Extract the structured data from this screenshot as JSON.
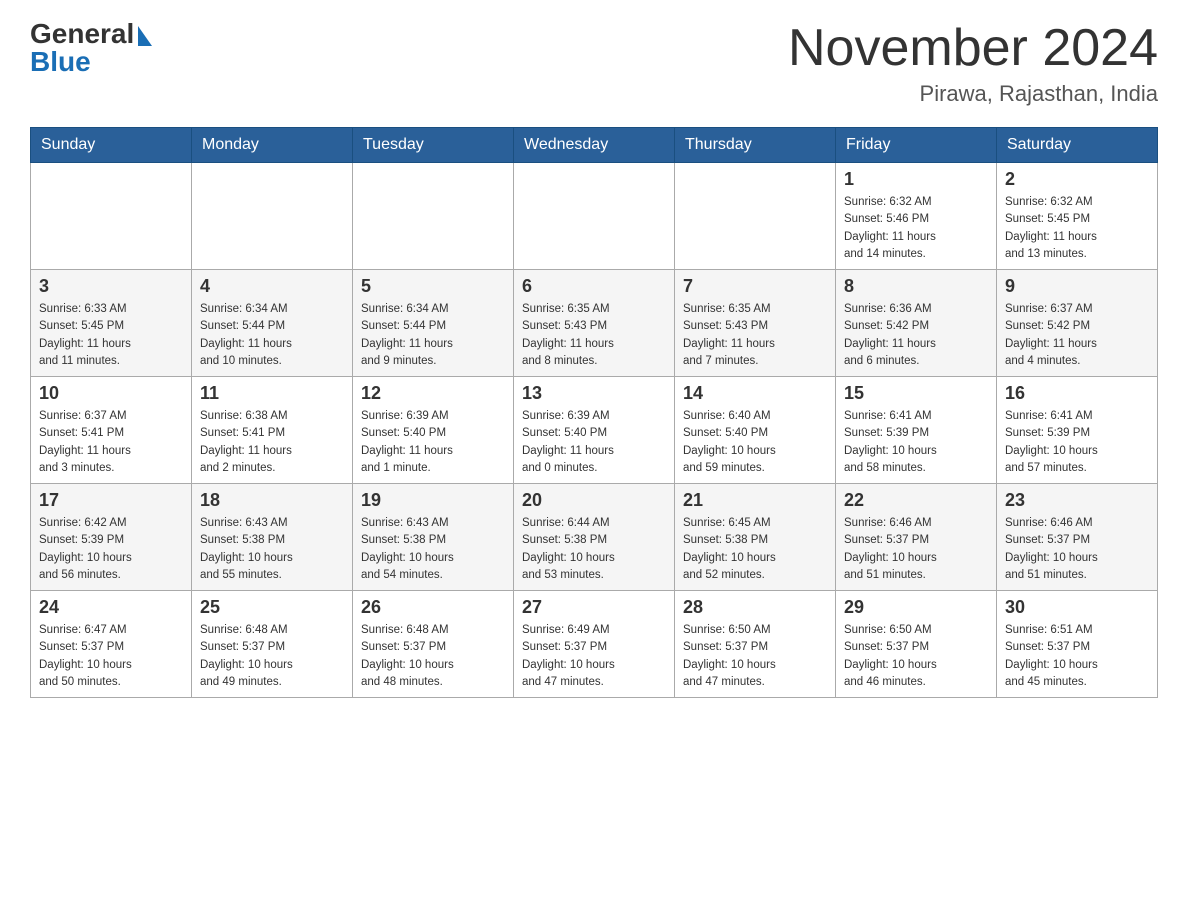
{
  "header": {
    "logo_general": "General",
    "logo_blue": "Blue",
    "calendar_title": "November 2024",
    "calendar_subtitle": "Pirawa, Rajasthan, India"
  },
  "weekdays": [
    "Sunday",
    "Monday",
    "Tuesday",
    "Wednesday",
    "Thursday",
    "Friday",
    "Saturday"
  ],
  "weeks": [
    [
      {
        "day": "",
        "info": ""
      },
      {
        "day": "",
        "info": ""
      },
      {
        "day": "",
        "info": ""
      },
      {
        "day": "",
        "info": ""
      },
      {
        "day": "",
        "info": ""
      },
      {
        "day": "1",
        "info": "Sunrise: 6:32 AM\nSunset: 5:46 PM\nDaylight: 11 hours\nand 14 minutes."
      },
      {
        "day": "2",
        "info": "Sunrise: 6:32 AM\nSunset: 5:45 PM\nDaylight: 11 hours\nand 13 minutes."
      }
    ],
    [
      {
        "day": "3",
        "info": "Sunrise: 6:33 AM\nSunset: 5:45 PM\nDaylight: 11 hours\nand 11 minutes."
      },
      {
        "day": "4",
        "info": "Sunrise: 6:34 AM\nSunset: 5:44 PM\nDaylight: 11 hours\nand 10 minutes."
      },
      {
        "day": "5",
        "info": "Sunrise: 6:34 AM\nSunset: 5:44 PM\nDaylight: 11 hours\nand 9 minutes."
      },
      {
        "day": "6",
        "info": "Sunrise: 6:35 AM\nSunset: 5:43 PM\nDaylight: 11 hours\nand 8 minutes."
      },
      {
        "day": "7",
        "info": "Sunrise: 6:35 AM\nSunset: 5:43 PM\nDaylight: 11 hours\nand 7 minutes."
      },
      {
        "day": "8",
        "info": "Sunrise: 6:36 AM\nSunset: 5:42 PM\nDaylight: 11 hours\nand 6 minutes."
      },
      {
        "day": "9",
        "info": "Sunrise: 6:37 AM\nSunset: 5:42 PM\nDaylight: 11 hours\nand 4 minutes."
      }
    ],
    [
      {
        "day": "10",
        "info": "Sunrise: 6:37 AM\nSunset: 5:41 PM\nDaylight: 11 hours\nand 3 minutes."
      },
      {
        "day": "11",
        "info": "Sunrise: 6:38 AM\nSunset: 5:41 PM\nDaylight: 11 hours\nand 2 minutes."
      },
      {
        "day": "12",
        "info": "Sunrise: 6:39 AM\nSunset: 5:40 PM\nDaylight: 11 hours\nand 1 minute."
      },
      {
        "day": "13",
        "info": "Sunrise: 6:39 AM\nSunset: 5:40 PM\nDaylight: 11 hours\nand 0 minutes."
      },
      {
        "day": "14",
        "info": "Sunrise: 6:40 AM\nSunset: 5:40 PM\nDaylight: 10 hours\nand 59 minutes."
      },
      {
        "day": "15",
        "info": "Sunrise: 6:41 AM\nSunset: 5:39 PM\nDaylight: 10 hours\nand 58 minutes."
      },
      {
        "day": "16",
        "info": "Sunrise: 6:41 AM\nSunset: 5:39 PM\nDaylight: 10 hours\nand 57 minutes."
      }
    ],
    [
      {
        "day": "17",
        "info": "Sunrise: 6:42 AM\nSunset: 5:39 PM\nDaylight: 10 hours\nand 56 minutes."
      },
      {
        "day": "18",
        "info": "Sunrise: 6:43 AM\nSunset: 5:38 PM\nDaylight: 10 hours\nand 55 minutes."
      },
      {
        "day": "19",
        "info": "Sunrise: 6:43 AM\nSunset: 5:38 PM\nDaylight: 10 hours\nand 54 minutes."
      },
      {
        "day": "20",
        "info": "Sunrise: 6:44 AM\nSunset: 5:38 PM\nDaylight: 10 hours\nand 53 minutes."
      },
      {
        "day": "21",
        "info": "Sunrise: 6:45 AM\nSunset: 5:38 PM\nDaylight: 10 hours\nand 52 minutes."
      },
      {
        "day": "22",
        "info": "Sunrise: 6:46 AM\nSunset: 5:37 PM\nDaylight: 10 hours\nand 51 minutes."
      },
      {
        "day": "23",
        "info": "Sunrise: 6:46 AM\nSunset: 5:37 PM\nDaylight: 10 hours\nand 51 minutes."
      }
    ],
    [
      {
        "day": "24",
        "info": "Sunrise: 6:47 AM\nSunset: 5:37 PM\nDaylight: 10 hours\nand 50 minutes."
      },
      {
        "day": "25",
        "info": "Sunrise: 6:48 AM\nSunset: 5:37 PM\nDaylight: 10 hours\nand 49 minutes."
      },
      {
        "day": "26",
        "info": "Sunrise: 6:48 AM\nSunset: 5:37 PM\nDaylight: 10 hours\nand 48 minutes."
      },
      {
        "day": "27",
        "info": "Sunrise: 6:49 AM\nSunset: 5:37 PM\nDaylight: 10 hours\nand 47 minutes."
      },
      {
        "day": "28",
        "info": "Sunrise: 6:50 AM\nSunset: 5:37 PM\nDaylight: 10 hours\nand 47 minutes."
      },
      {
        "day": "29",
        "info": "Sunrise: 6:50 AM\nSunset: 5:37 PM\nDaylight: 10 hours\nand 46 minutes."
      },
      {
        "day": "30",
        "info": "Sunrise: 6:51 AM\nSunset: 5:37 PM\nDaylight: 10 hours\nand 45 minutes."
      }
    ]
  ]
}
